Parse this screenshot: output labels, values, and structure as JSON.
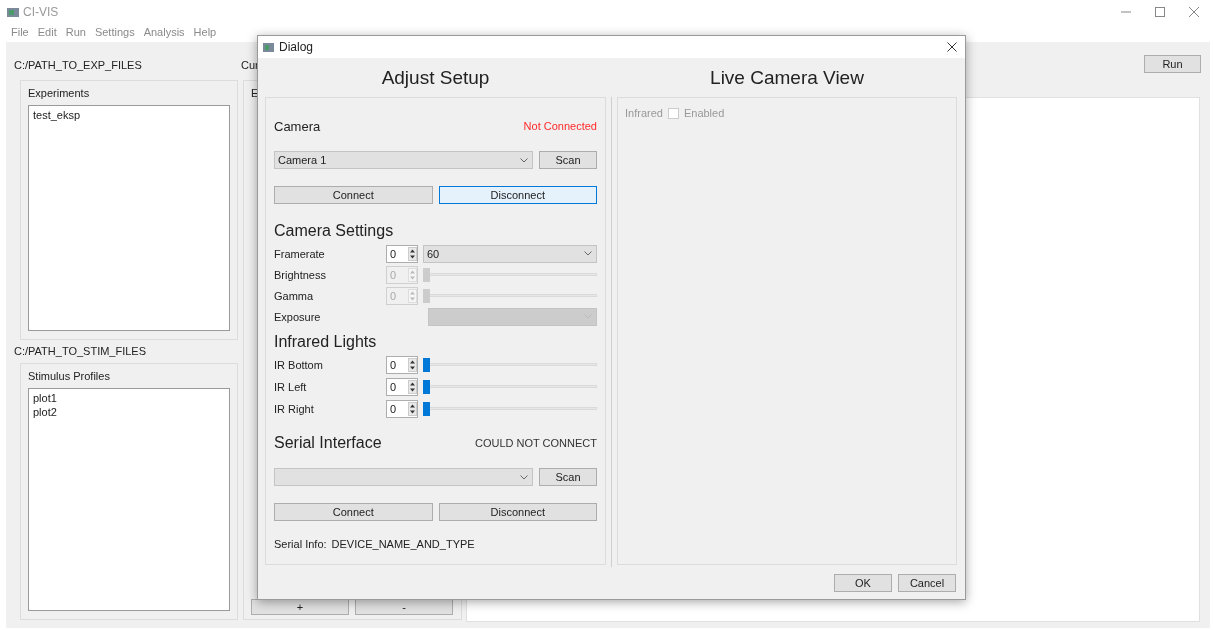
{
  "window": {
    "title": "CI-VIS",
    "menu": [
      "File",
      "Edit",
      "Run",
      "Settings",
      "Analysis",
      "Help"
    ]
  },
  "experiments": {
    "path": "C:/PATH_TO_EXP_FILES",
    "title": "Experiments",
    "items": [
      {
        "label": "test_eksp",
        "selected": false
      }
    ]
  },
  "stimulus": {
    "path": "C:/PATH_TO_STIM_FILES",
    "title": "Stimulus Profiles",
    "items": [
      {
        "label": "plot1",
        "selected": false
      },
      {
        "label": "plot2",
        "selected": false
      }
    ]
  },
  "current": {
    "label": "Cur",
    "title": "E",
    "buttons": [
      "+",
      "-"
    ]
  },
  "run_button": "Run",
  "dialog": {
    "title": "Dialog",
    "setup_heading": "Adjust Setup",
    "camera": {
      "heading": "Camera",
      "status": "Not Connected",
      "status_error": true,
      "device": "Camera 1",
      "scan": "Scan",
      "buttons": [
        {
          "label": "Connect",
          "focused": false
        },
        {
          "label": "Disconnect",
          "focused": true
        }
      ]
    },
    "camera_settings": {
      "heading": "Camera Settings",
      "rows": [
        {
          "kind": "spin_combo",
          "label": "Framerate",
          "value": "0",
          "choice": "60",
          "disabled": false
        },
        {
          "kind": "spin_slider",
          "label": "Brightness",
          "value": "0",
          "level": 0,
          "disabled": true
        },
        {
          "kind": "spin_slider",
          "label": "Gamma",
          "value": "0",
          "level": 0,
          "disabled": true
        },
        {
          "kind": "combo",
          "label": "Exposure",
          "disabled": true
        }
      ]
    },
    "infrared_lights": {
      "heading": "Infrared Lights",
      "rows": [
        {
          "kind": "spin_slider",
          "label": "IR Bottom",
          "value": "0",
          "level": 0,
          "disabled": false
        },
        {
          "kind": "spin_slider",
          "label": "IR Left",
          "value": "0",
          "level": 0,
          "disabled": false
        },
        {
          "kind": "spin_slider",
          "label": "IR Right",
          "value": "0",
          "level": 0,
          "disabled": false
        }
      ]
    },
    "serial": {
      "heading": "Serial Interface",
      "status": "COULD NOT CONNECT",
      "status_error": false,
      "scan": "Scan",
      "buttons": [
        {
          "label": "Connect",
          "focused": false
        },
        {
          "label": "Disconnect",
          "focused": false
        }
      ],
      "info_label": "Serial Info:",
      "info_value": "DEVICE_NAME_AND_TYPE"
    },
    "live_view": {
      "heading": "Live Camera View",
      "infrared_label": "Infrared",
      "checkbox": {
        "label": "Enabled",
        "checked": false,
        "disabled": true
      }
    },
    "buttons": [
      "OK",
      "Cancel"
    ]
  }
}
